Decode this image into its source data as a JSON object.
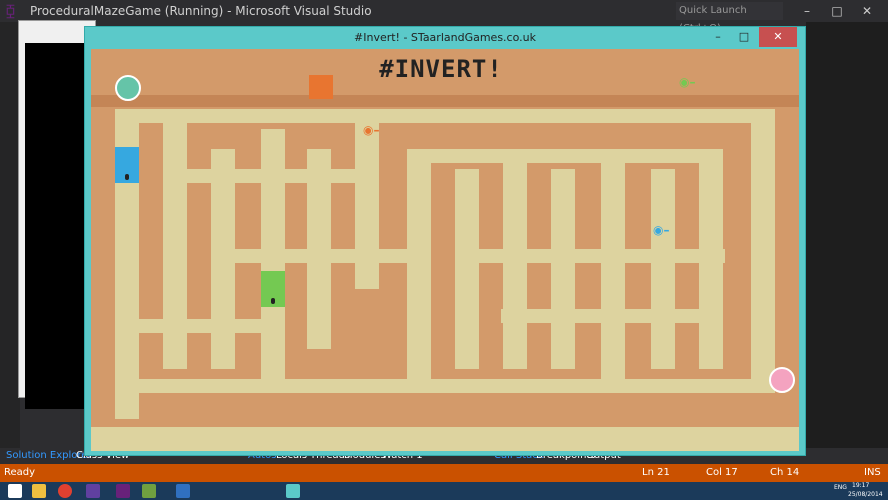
{
  "vs": {
    "title": "ProceduralMazeGame (Running) - Microsoft Visual Studio",
    "quick_launch_placeholder": "Quick Launch (Ctrl+Q)",
    "bottom_tabs": [
      "Solution Explorer",
      "Class View",
      "Autos",
      "Locals",
      "Threads",
      "Modules",
      "Watch 1",
      "Call Stack",
      "Breakpoints",
      "Output"
    ],
    "status": {
      "ready": "Ready",
      "line": "Ln 21",
      "col": "Col 17",
      "ch": "Ch 14",
      "mode": "INS"
    },
    "clock": {
      "time": "19:17",
      "date": "25/08/2014",
      "lang": "ENG"
    }
  },
  "game": {
    "window_title": "#Invert! - STaarlandGames.co.uk",
    "logo": "#INVERT!",
    "colors": {
      "path": "#ddd39f",
      "wall": "#c48556",
      "frame": "#5bc9c9",
      "orange": "#e87530",
      "blue": "#36a8e0",
      "green": "#74c952",
      "pink": "#f4a3c0",
      "teal": "#65c4a8"
    }
  }
}
